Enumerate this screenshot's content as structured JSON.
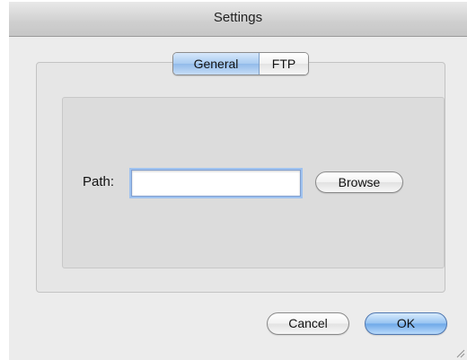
{
  "window": {
    "title": "Settings"
  },
  "tabs": [
    {
      "label": "General",
      "selected": true
    },
    {
      "label": "FTP",
      "selected": false
    }
  ],
  "general": {
    "path_label": "Path:",
    "path_value": "",
    "browse_label": "Browse"
  },
  "footer": {
    "cancel_label": "Cancel",
    "ok_label": "OK"
  },
  "icons": {
    "resize": "resize-grip-icon"
  },
  "colors": {
    "selected_tab": "#a9cbf1",
    "default_button": "#6ea8e8",
    "focus_ring": "#9fc2ef"
  }
}
